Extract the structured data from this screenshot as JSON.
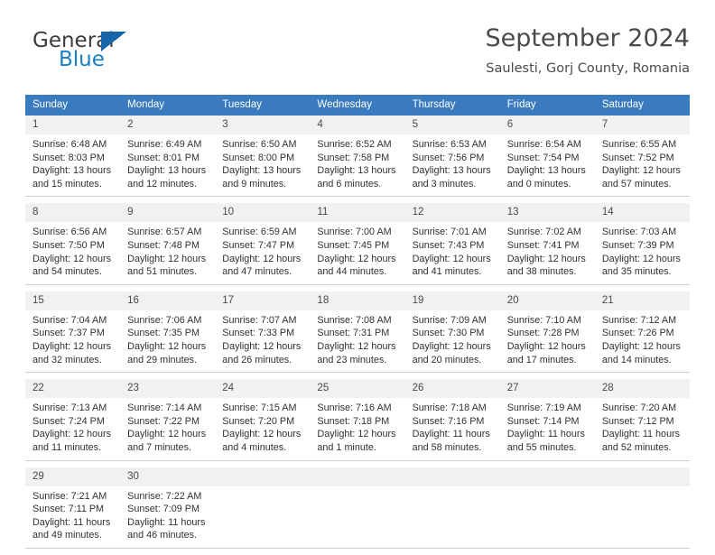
{
  "brand": {
    "name_top": "General",
    "name_bottom": "Blue",
    "triangle_icon": "blue-triangle-logo-icon",
    "color_dark": "#3b3b3b",
    "color_blue": "#1c7fc4"
  },
  "header": {
    "title": "September 2024",
    "subtitle": "Saulesti, Gorj County, Romania"
  },
  "calendar": {
    "header_bg": "#3a7bbf",
    "daynum_bg": "#f1f1f1",
    "weekdays": [
      "Sunday",
      "Monday",
      "Tuesday",
      "Wednesday",
      "Thursday",
      "Friday",
      "Saturday"
    ],
    "weeks": [
      [
        {
          "day": "1",
          "lines": [
            "Sunrise: 6:48 AM",
            "Sunset: 8:03 PM",
            "Daylight: 13 hours",
            "and 15 minutes."
          ]
        },
        {
          "day": "2",
          "lines": [
            "Sunrise: 6:49 AM",
            "Sunset: 8:01 PM",
            "Daylight: 13 hours",
            "and 12 minutes."
          ]
        },
        {
          "day": "3",
          "lines": [
            "Sunrise: 6:50 AM",
            "Sunset: 8:00 PM",
            "Daylight: 13 hours",
            "and 9 minutes."
          ]
        },
        {
          "day": "4",
          "lines": [
            "Sunrise: 6:52 AM",
            "Sunset: 7:58 PM",
            "Daylight: 13 hours",
            "and 6 minutes."
          ]
        },
        {
          "day": "5",
          "lines": [
            "Sunrise: 6:53 AM",
            "Sunset: 7:56 PM",
            "Daylight: 13 hours",
            "and 3 minutes."
          ]
        },
        {
          "day": "6",
          "lines": [
            "Sunrise: 6:54 AM",
            "Sunset: 7:54 PM",
            "Daylight: 13 hours",
            "and 0 minutes."
          ]
        },
        {
          "day": "7",
          "lines": [
            "Sunrise: 6:55 AM",
            "Sunset: 7:52 PM",
            "Daylight: 12 hours",
            "and 57 minutes."
          ]
        }
      ],
      [
        {
          "day": "8",
          "lines": [
            "Sunrise: 6:56 AM",
            "Sunset: 7:50 PM",
            "Daylight: 12 hours",
            "and 54 minutes."
          ]
        },
        {
          "day": "9",
          "lines": [
            "Sunrise: 6:57 AM",
            "Sunset: 7:48 PM",
            "Daylight: 12 hours",
            "and 51 minutes."
          ]
        },
        {
          "day": "10",
          "lines": [
            "Sunrise: 6:59 AM",
            "Sunset: 7:47 PM",
            "Daylight: 12 hours",
            "and 47 minutes."
          ]
        },
        {
          "day": "11",
          "lines": [
            "Sunrise: 7:00 AM",
            "Sunset: 7:45 PM",
            "Daylight: 12 hours",
            "and 44 minutes."
          ]
        },
        {
          "day": "12",
          "lines": [
            "Sunrise: 7:01 AM",
            "Sunset: 7:43 PM",
            "Daylight: 12 hours",
            "and 41 minutes."
          ]
        },
        {
          "day": "13",
          "lines": [
            "Sunrise: 7:02 AM",
            "Sunset: 7:41 PM",
            "Daylight: 12 hours",
            "and 38 minutes."
          ]
        },
        {
          "day": "14",
          "lines": [
            "Sunrise: 7:03 AM",
            "Sunset: 7:39 PM",
            "Daylight: 12 hours",
            "and 35 minutes."
          ]
        }
      ],
      [
        {
          "day": "15",
          "lines": [
            "Sunrise: 7:04 AM",
            "Sunset: 7:37 PM",
            "Daylight: 12 hours",
            "and 32 minutes."
          ]
        },
        {
          "day": "16",
          "lines": [
            "Sunrise: 7:06 AM",
            "Sunset: 7:35 PM",
            "Daylight: 12 hours",
            "and 29 minutes."
          ]
        },
        {
          "day": "17",
          "lines": [
            "Sunrise: 7:07 AM",
            "Sunset: 7:33 PM",
            "Daylight: 12 hours",
            "and 26 minutes."
          ]
        },
        {
          "day": "18",
          "lines": [
            "Sunrise: 7:08 AM",
            "Sunset: 7:31 PM",
            "Daylight: 12 hours",
            "and 23 minutes."
          ]
        },
        {
          "day": "19",
          "lines": [
            "Sunrise: 7:09 AM",
            "Sunset: 7:30 PM",
            "Daylight: 12 hours",
            "and 20 minutes."
          ]
        },
        {
          "day": "20",
          "lines": [
            "Sunrise: 7:10 AM",
            "Sunset: 7:28 PM",
            "Daylight: 12 hours",
            "and 17 minutes."
          ]
        },
        {
          "day": "21",
          "lines": [
            "Sunrise: 7:12 AM",
            "Sunset: 7:26 PM",
            "Daylight: 12 hours",
            "and 14 minutes."
          ]
        }
      ],
      [
        {
          "day": "22",
          "lines": [
            "Sunrise: 7:13 AM",
            "Sunset: 7:24 PM",
            "Daylight: 12 hours",
            "and 11 minutes."
          ]
        },
        {
          "day": "23",
          "lines": [
            "Sunrise: 7:14 AM",
            "Sunset: 7:22 PM",
            "Daylight: 12 hours",
            "and 7 minutes."
          ]
        },
        {
          "day": "24",
          "lines": [
            "Sunrise: 7:15 AM",
            "Sunset: 7:20 PM",
            "Daylight: 12 hours",
            "and 4 minutes."
          ]
        },
        {
          "day": "25",
          "lines": [
            "Sunrise: 7:16 AM",
            "Sunset: 7:18 PM",
            "Daylight: 12 hours",
            "and 1 minute."
          ]
        },
        {
          "day": "26",
          "lines": [
            "Sunrise: 7:18 AM",
            "Sunset: 7:16 PM",
            "Daylight: 11 hours",
            "and 58 minutes."
          ]
        },
        {
          "day": "27",
          "lines": [
            "Sunrise: 7:19 AM",
            "Sunset: 7:14 PM",
            "Daylight: 11 hours",
            "and 55 minutes."
          ]
        },
        {
          "day": "28",
          "lines": [
            "Sunrise: 7:20 AM",
            "Sunset: 7:12 PM",
            "Daylight: 11 hours",
            "and 52 minutes."
          ]
        }
      ],
      [
        {
          "day": "29",
          "lines": [
            "Sunrise: 7:21 AM",
            "Sunset: 7:11 PM",
            "Daylight: 11 hours",
            "and 49 minutes."
          ]
        },
        {
          "day": "30",
          "lines": [
            "Sunrise: 7:22 AM",
            "Sunset: 7:09 PM",
            "Daylight: 11 hours",
            "and 46 minutes."
          ]
        },
        {
          "day": "",
          "lines": []
        },
        {
          "day": "",
          "lines": []
        },
        {
          "day": "",
          "lines": []
        },
        {
          "day": "",
          "lines": []
        },
        {
          "day": "",
          "lines": []
        }
      ]
    ]
  }
}
